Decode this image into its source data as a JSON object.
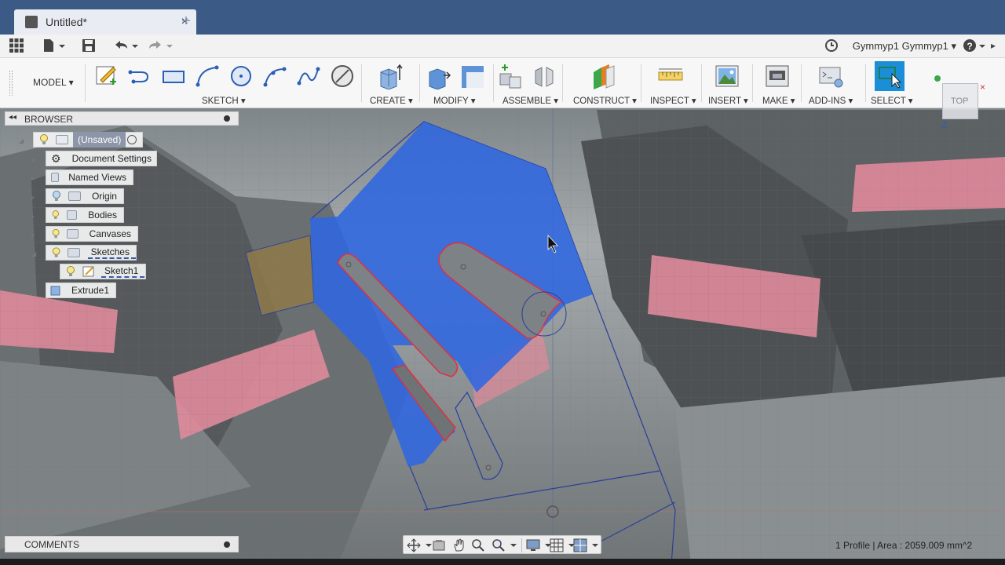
{
  "tab": {
    "title": "Untitled*",
    "close": "×",
    "new_tab": "+"
  },
  "quickbar": {
    "user": "Gymmyp1 Gymmyp1 ▾",
    "help": "?"
  },
  "toolbar": {
    "workspace": "MODEL ▾",
    "groups": {
      "sketch": "SKETCH ▾",
      "create": "CREATE ▾",
      "modify": "MODIFY ▾",
      "assemble": "ASSEMBLE ▾",
      "construct": "CONSTRUCT ▾",
      "inspect": "INSPECT ▾",
      "insert": "INSERT ▾",
      "make": "MAKE ▾",
      "addins": "ADD-INS ▾",
      "select": "SELECT ▾"
    }
  },
  "browser": {
    "title": "BROWSER",
    "items": [
      {
        "label": "(Unsaved)"
      },
      {
        "label": "Document Settings"
      },
      {
        "label": "Named Views"
      },
      {
        "label": "Origin"
      },
      {
        "label": "Bodies"
      },
      {
        "label": "Canvases"
      },
      {
        "label": "Sketches"
      },
      {
        "label": "Sketch1"
      },
      {
        "label": "Extrude1"
      }
    ]
  },
  "comments": {
    "title": "COMMENTS"
  },
  "status": {
    "text": "1 Profile | Area : 2059.009 mm^2"
  },
  "viewcube": {
    "face": "TOP"
  },
  "colors": {
    "accent": "#3c5a86",
    "profile": "#2f66e0",
    "sketch_line": "#e03040"
  }
}
